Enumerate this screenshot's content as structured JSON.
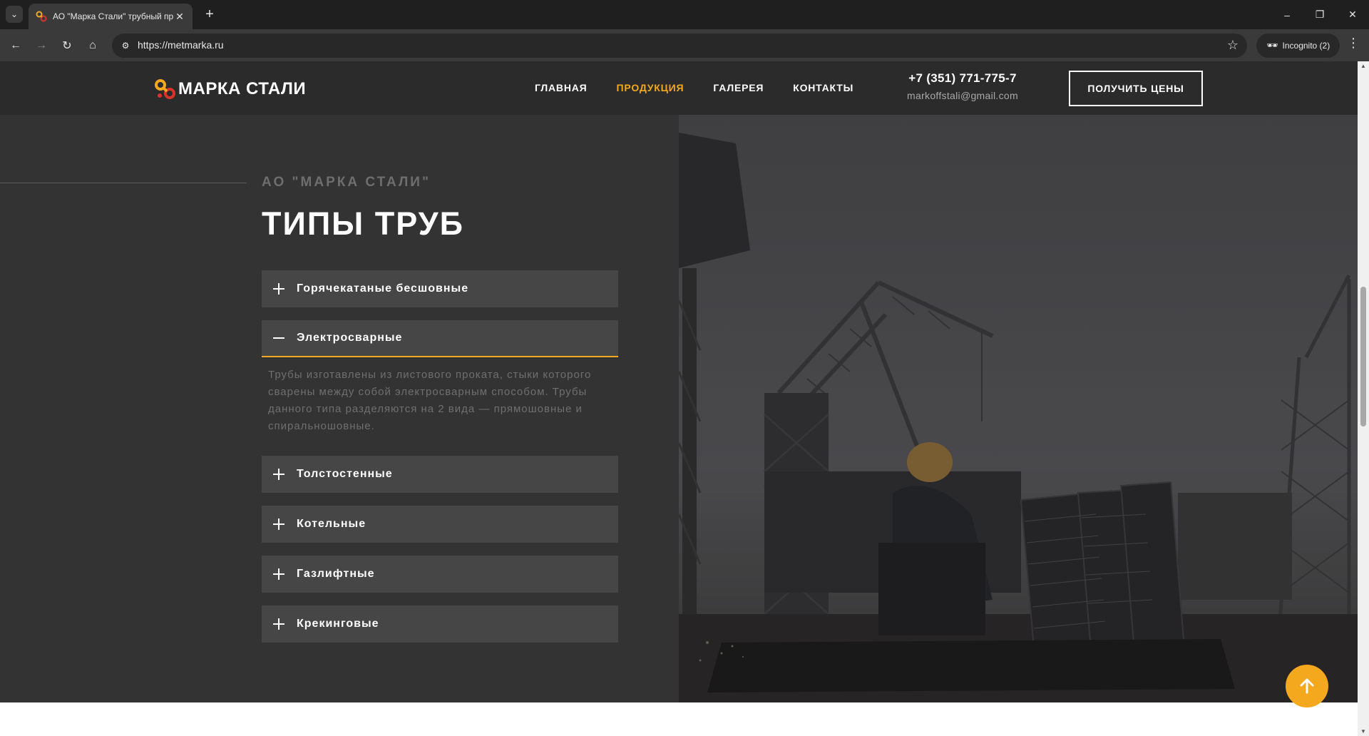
{
  "browser": {
    "tab_title": "АО \"Марка Стали\" трубный пр",
    "tab_close_icon": "close-icon",
    "url": "https://metmarka.ru",
    "incognito_label": "Incognito (2)",
    "controls": {
      "minimize": "–",
      "restore": "❐",
      "close": "✕"
    }
  },
  "header": {
    "logo_text": "МАРКА СТАЛИ",
    "nav": [
      {
        "label": "ГЛАВНАЯ",
        "active": false
      },
      {
        "label": "ПРОДУКЦИЯ",
        "active": true
      },
      {
        "label": "ГАЛЕРЕЯ",
        "active": false
      },
      {
        "label": "КОНТАКТЫ",
        "active": false
      }
    ],
    "phone": "+7 (351) 771-775-7",
    "email": "markoffstali@gmail.com",
    "cta_label": "ПОЛУЧИТЬ ЦЕНЫ"
  },
  "section": {
    "subtitle": "АО \"МАРКА СТАЛИ\"",
    "title": "ТИПЫ ТРУБ",
    "accordion": [
      {
        "label": "Горячекатаные бесшовные",
        "expanded": false
      },
      {
        "label": "Электросварные",
        "expanded": true,
        "body": "Трубы изготавлены из листового проката, стыки которого сварены между собой электросварным способом. Трубы данного типа разделяются на 2 вида — прямошовные и спиральношовные."
      },
      {
        "label": "Толстостенные",
        "expanded": false
      },
      {
        "label": "Котельные",
        "expanded": false
      },
      {
        "label": "Газлифтные",
        "expanded": false
      },
      {
        "label": "Крекинговые",
        "expanded": false
      }
    ]
  },
  "colors": {
    "accent": "#f4a81d",
    "header_bg": "#2b2b2b",
    "section_bg": "#333333",
    "accordion_bg": "#464646"
  }
}
